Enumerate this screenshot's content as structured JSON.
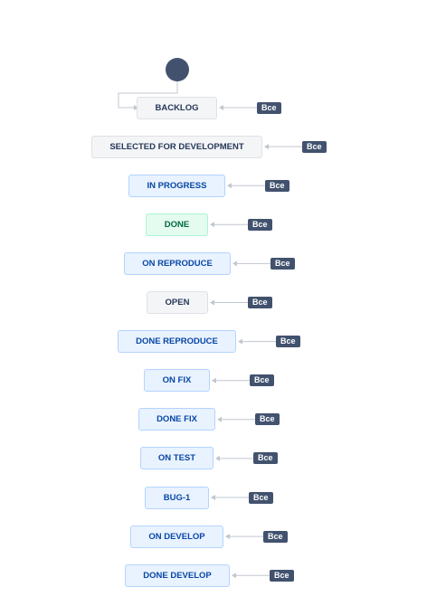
{
  "workflow": {
    "all_label": "Все",
    "statuses": [
      {
        "name": "BACKLOG",
        "category": "todo"
      },
      {
        "name": "SELECTED FOR DEVELOPMENT",
        "category": "todo"
      },
      {
        "name": "IN PROGRESS",
        "category": "inprogress"
      },
      {
        "name": "DONE",
        "category": "done"
      },
      {
        "name": "ON REPRODUCE",
        "category": "inprogress"
      },
      {
        "name": "OPEN",
        "category": "todo"
      },
      {
        "name": "DONE REPRODUCE",
        "category": "inprogress"
      },
      {
        "name": "ON FIX",
        "category": "inprogress"
      },
      {
        "name": "DONE FIX",
        "category": "inprogress"
      },
      {
        "name": "ON TEST",
        "category": "inprogress"
      },
      {
        "name": "BUG-1",
        "category": "inprogress"
      },
      {
        "name": "ON DEVELOP",
        "category": "inprogress"
      },
      {
        "name": "DONE DEVELOP",
        "category": "inprogress"
      }
    ]
  },
  "colors": {
    "start_node": "#42526e",
    "todo": "#f4f5f7",
    "inprogress": "#e9f2ff",
    "done": "#e3fcef",
    "badge": "#42526e",
    "connector": "#c1c7d0"
  }
}
